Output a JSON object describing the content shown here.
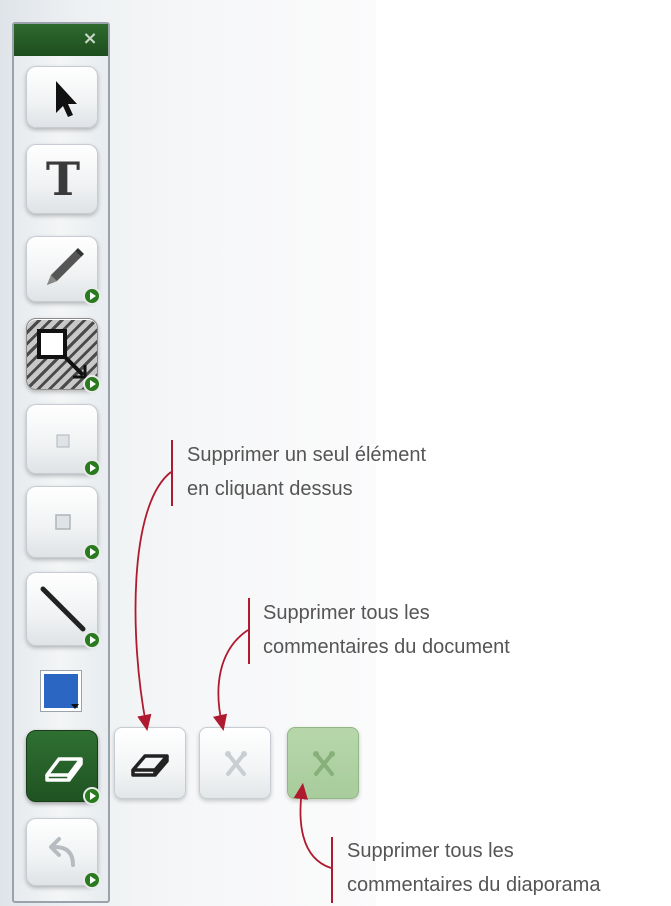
{
  "toolbar": {
    "close_glyph": "×",
    "tools": [
      {
        "name": "select-tool",
        "icon": "arrow-cursor-icon",
        "has_submenu": false
      },
      {
        "name": "text-tool",
        "icon": "text-t-icon",
        "label": "T",
        "has_submenu": false
      },
      {
        "name": "pen-tool",
        "icon": "pencil-icon",
        "has_submenu": true
      },
      {
        "name": "selection-rectangle-tool",
        "icon": "selection-rectangle-icon",
        "has_submenu": true
      },
      {
        "name": "shape-tool-1",
        "icon": "small-square-icon",
        "has_submenu": true
      },
      {
        "name": "shape-tool-2",
        "icon": "small-square-icon",
        "has_submenu": true
      },
      {
        "name": "line-tool",
        "icon": "diagonal-line-icon",
        "has_submenu": true
      },
      {
        "name": "color-picker",
        "icon": "color-swatch-icon",
        "has_submenu": false
      },
      {
        "name": "eraser-tool",
        "icon": "eraser-icon",
        "active": true,
        "has_submenu": true
      },
      {
        "name": "undo-tool",
        "icon": "undo-arrow-icon",
        "has_submenu": true
      }
    ],
    "selected_color": "#2a66c2",
    "accent_color": "#2a6e2c"
  },
  "eraser_options": [
    {
      "name": "erase-single-element",
      "icon": "eraser-icon"
    },
    {
      "name": "delete-all-document-comments",
      "icon": "delete-cross-icon",
      "disabled": true
    },
    {
      "name": "delete-all-slideshow-comments",
      "icon": "delete-cross-icon",
      "disabled": true
    }
  ],
  "annotations": {
    "single": {
      "line1": "Supprimer un seul élément",
      "line2": "en cliquant dessus"
    },
    "document": {
      "line1": "Supprimer tous les",
      "line2": "commentaires du document"
    },
    "slideshow": {
      "line1": "Supprimer tous les",
      "line2": "commentaires du diaporama"
    },
    "marker_color": "#b01a30"
  }
}
